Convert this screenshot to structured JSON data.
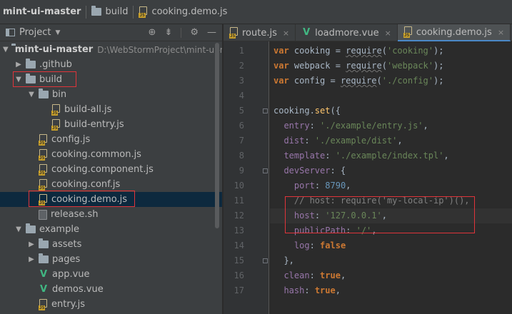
{
  "breadcrumb": [
    {
      "label": "mint-ui-master",
      "icon": "none"
    },
    {
      "label": "build",
      "icon": "folder-icon"
    },
    {
      "label": "cooking.demo.js",
      "icon": "js-file-icon"
    }
  ],
  "panel": {
    "title": "Project",
    "tools": [
      "target-icon",
      "collapse-icon",
      "gear-icon",
      "minimize-icon"
    ]
  },
  "tree": [
    {
      "label": "mint-ui-master",
      "path": "D:\\WebStormProject\\mint-ui-m",
      "arrow": "▼",
      "icon": "folder",
      "depth": 0,
      "bold": true
    },
    {
      "label": ".github",
      "arrow": "▶",
      "icon": "folder",
      "depth": 1
    },
    {
      "label": "build",
      "arrow": "▼",
      "icon": "folder",
      "depth": 1
    },
    {
      "label": "bin",
      "arrow": "▼",
      "icon": "folder",
      "depth": 2
    },
    {
      "label": "build-all.js",
      "icon": "js",
      "depth": 3
    },
    {
      "label": "build-entry.js",
      "icon": "js",
      "depth": 3
    },
    {
      "label": "config.js",
      "icon": "js",
      "depth": 2
    },
    {
      "label": "cooking.common.js",
      "icon": "js",
      "depth": 2
    },
    {
      "label": "cooking.component.js",
      "icon": "js",
      "depth": 2
    },
    {
      "label": "cooking.conf.js",
      "icon": "js",
      "depth": 2
    },
    {
      "label": "cooking.demo.js",
      "icon": "js",
      "depth": 2,
      "selected": true
    },
    {
      "label": "release.sh",
      "icon": "sh",
      "depth": 2
    },
    {
      "label": "example",
      "arrow": "▼",
      "icon": "folder",
      "depth": 1
    },
    {
      "label": "assets",
      "arrow": "▶",
      "icon": "folder",
      "depth": 2
    },
    {
      "label": "pages",
      "arrow": "▶",
      "icon": "folder",
      "depth": 2
    },
    {
      "label": "app.vue",
      "icon": "vue",
      "depth": 2
    },
    {
      "label": "demos.vue",
      "icon": "vue",
      "depth": 2
    },
    {
      "label": "entry.js",
      "icon": "js",
      "depth": 2
    }
  ],
  "tabs": [
    {
      "label": "route.js",
      "icon": "js",
      "close": "×"
    },
    {
      "label": "loadmore.vue",
      "icon": "vue",
      "close": "×"
    },
    {
      "label": "cooking.demo.js",
      "icon": "js",
      "close": "×",
      "active": true
    }
  ],
  "code": {
    "line_numbers": [
      "1",
      "2",
      "3",
      "4",
      "5",
      "6",
      "7",
      "8",
      "9",
      "10",
      "11",
      "12",
      "13",
      "14",
      "15",
      "16",
      "17"
    ],
    "lines": [
      "var cooking = require('cooking');",
      "var webpack = require('webpack');",
      "var config = require('./config');",
      "",
      "cooking.set({",
      "  entry: './example/entry.js',",
      "  dist: './example/dist',",
      "  template: './example/index.tpl',",
      "  devServer: {",
      "    port: 8790,",
      "    // host: require('my-local-ip')(),",
      "    host: '127.0.0.1',",
      "    publicPath: '/',",
      "    log: false",
      "  },",
      "  clean: true,",
      "  hash: true,"
    ]
  }
}
